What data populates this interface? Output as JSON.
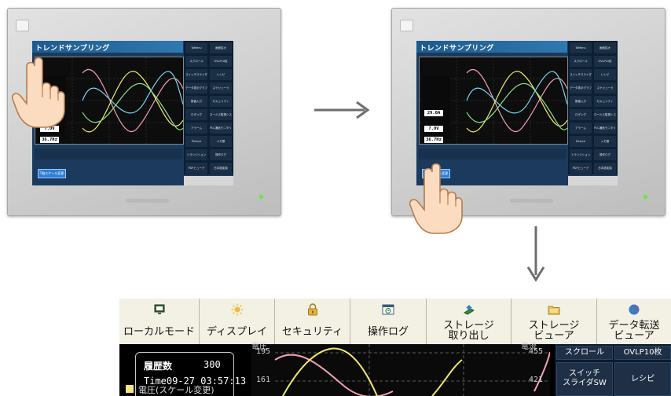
{
  "device": {
    "screen_title": "トレンドサンプリング",
    "side_buttons": [
      "ToMenu",
      "画面拡大",
      "スクロール",
      "OVLP10枚",
      "スイッチスライダSW",
      "レシピ",
      "データ表示グラフ表示",
      "スケジューラ",
      "数値入力",
      "セキュリティ",
      "ロギング",
      "ロールス監視システム",
      "アラーム",
      "PLC通信モニタリング",
      "Picture",
      "メモ帳",
      "トランジション",
      "操作ログ",
      "PDFビューア",
      "日本語変換"
    ],
    "panel_values": [
      "29.0A",
      "7.0V",
      "36.7Hz"
    ],
    "blue_button": "T軸スケール変更"
  },
  "zoom": {
    "menubar": [
      {
        "label": "ローカルモード",
        "icon": "monitor-icon"
      },
      {
        "label": "ディスプレイ",
        "icon": "sun-icon"
      },
      {
        "label": "セキュリティ",
        "icon": "padlock-icon"
      },
      {
        "label": "操作ログ",
        "icon": "log-clock-icon"
      },
      {
        "label": "ストレージ\n取り出し",
        "icon": "eject-storage-icon"
      },
      {
        "label": "ストレージ\nビューア",
        "icon": "folder-icon"
      },
      {
        "label": "データ転送\nビューア",
        "icon": "globe-icon"
      }
    ],
    "history_label": "履歴数",
    "history_value": "300",
    "time_text": "Time09-27 03:57:13",
    "legend_text": "電圧(スケール変更)",
    "trend": {
      "left_axis_label": "電圧",
      "right_axis_label": "電流",
      "left_ticks": [
        "195",
        "161"
      ],
      "right_ticks": [
        "455",
        "421"
      ]
    },
    "right_buttons": [
      "スクロール",
      "OVLP10枚",
      "スイッチ\nスライダSW",
      "レシピ"
    ]
  },
  "colors": {
    "menubar_bg": "#f3f1e4",
    "trend_pink": "#f2a1b2",
    "trend_yellow": "#f2ea6a",
    "arrow": "#6e6e6e"
  }
}
